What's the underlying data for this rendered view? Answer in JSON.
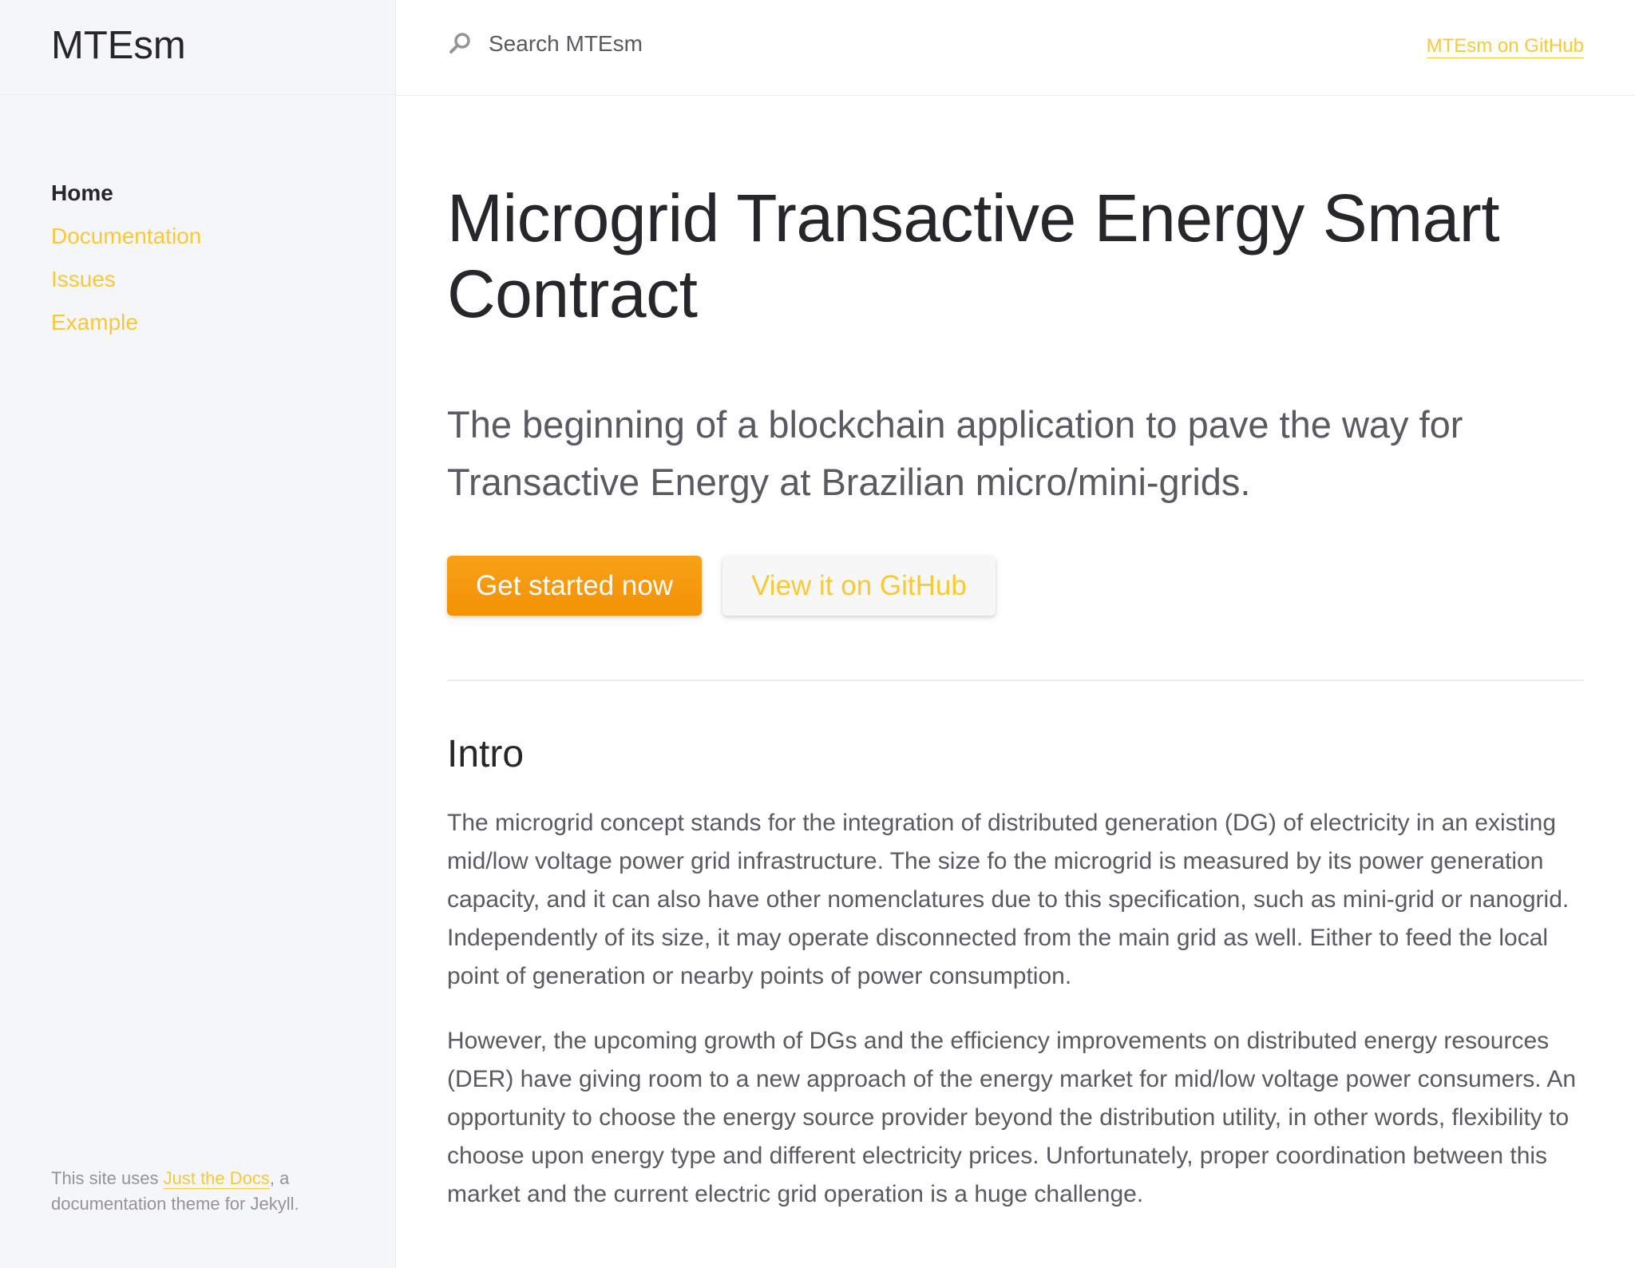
{
  "sidebar": {
    "site_title": "MTEsm",
    "nav": [
      {
        "label": "Home",
        "active": true
      },
      {
        "label": "Documentation",
        "active": false
      },
      {
        "label": "Issues",
        "active": false
      },
      {
        "label": "Example",
        "active": false
      }
    ],
    "footer": {
      "prefix": "This site uses ",
      "link": "Just the Docs",
      "suffix": ", a documentation theme for Jekyll."
    }
  },
  "header": {
    "search": {
      "placeholder": "Search MTEsm",
      "icon": "search-icon"
    },
    "aux_link": "MTEsm on GitHub"
  },
  "main": {
    "title": "Microgrid Transactive Energy Smart Contract",
    "lead": "The beginning of a blockchain application to pave the way for Transactive Energy at Brazilian micro/mini-grids.",
    "buttons": {
      "primary": "Get started now",
      "secondary": "View it on GitHub"
    },
    "section_title": "Intro",
    "paragraphs": [
      "The microgrid concept stands for the integration of distributed generation (DG) of electricity in an existing mid/low voltage power grid infrastructure. The size fo the microgrid is measured by its power generation capacity, and it can also have other nomenclatures due to this specification, such as mini-grid or nanogrid. Independently of its size, it may operate disconnected from the main grid as well. Either to feed the local point of generation or nearby points of power consumption.",
      "However, the upcoming growth of DGs and the efficiency improvements on distributed energy resources (DER) have giving room to a new approach of the energy market for mid/low voltage power consumers. An opportunity to choose the energy source provider beyond the distribution utility, in other words, flexibility to choose upon energy type and different electricity prices. Unfortunately, proper coordination between this market and the current electric grid operation is a huge challenge."
    ]
  },
  "colors": {
    "link": "#f8c935",
    "primary_button": "#f39204",
    "sidebar_bg": "#f5f6fa",
    "heading": "#27262b",
    "body_text": "#5c5962"
  }
}
